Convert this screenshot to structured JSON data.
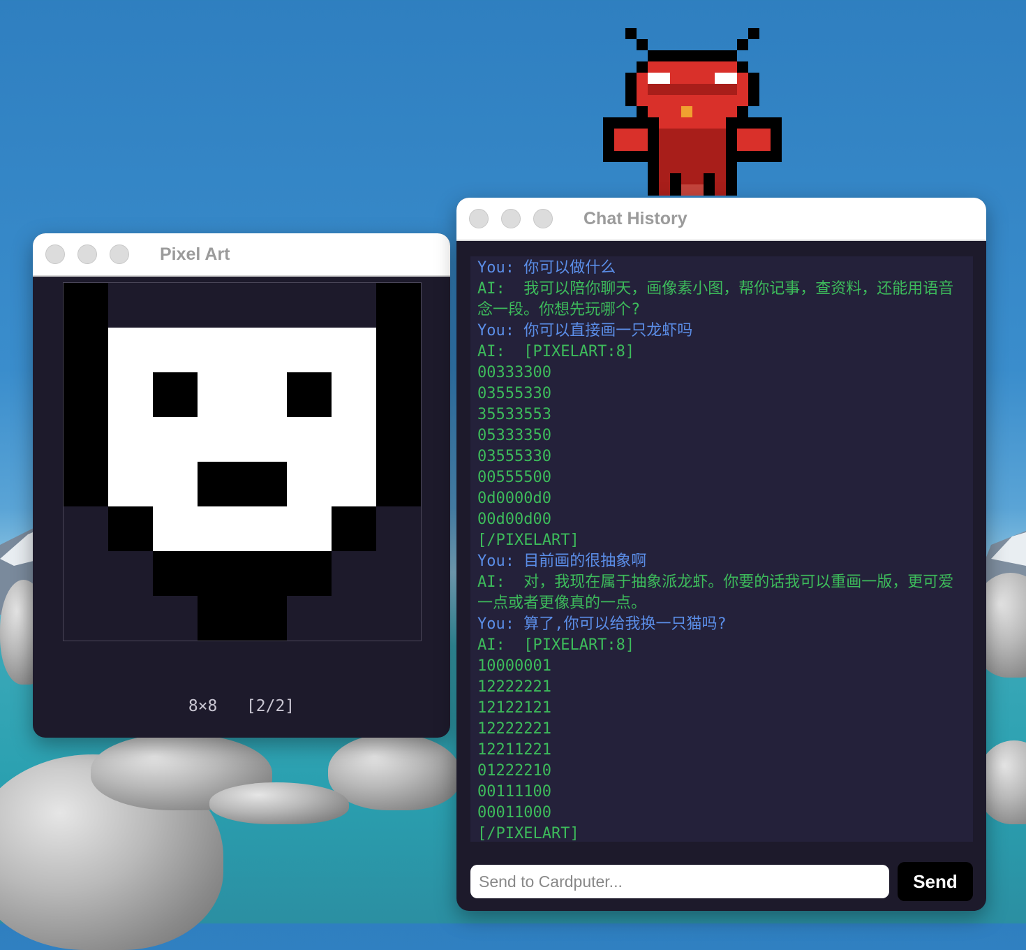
{
  "pixel_window": {
    "title": "Pixel Art",
    "caption_size": "8×8",
    "caption_page": "[2/2]",
    "rows": [
      "10000001",
      "12222221",
      "12122121",
      "12222221",
      "12211221",
      "01222210",
      "00111100",
      "00011000"
    ],
    "palette": {
      "0": "#1d1a2b",
      "1": "#000000",
      "2": "#ffffff"
    }
  },
  "chat_window": {
    "title": "Chat History",
    "messages": [
      {
        "speaker": "you",
        "text": "You: 你可以做什么"
      },
      {
        "speaker": "ai",
        "text": "AI:  我可以陪你聊天，画像素小图，帮你记事，查资料，还能用语音念一段。你想先玩哪个?"
      },
      {
        "speaker": "you",
        "text": "You: 你可以直接画一只龙虾吗"
      },
      {
        "speaker": "ai",
        "text": "AI:  [PIXELART:8]"
      },
      {
        "speaker": "ai",
        "text": "00333300"
      },
      {
        "speaker": "ai",
        "text": "03555330"
      },
      {
        "speaker": "ai",
        "text": "35533553"
      },
      {
        "speaker": "ai",
        "text": "05333350"
      },
      {
        "speaker": "ai",
        "text": "03555330"
      },
      {
        "speaker": "ai",
        "text": "00555500"
      },
      {
        "speaker": "ai",
        "text": "0d0000d0"
      },
      {
        "speaker": "ai",
        "text": "00d00d00"
      },
      {
        "speaker": "ai",
        "text": "[/PIXELART]"
      },
      {
        "speaker": "you",
        "text": "You: 目前画的很抽象啊"
      },
      {
        "speaker": "ai",
        "text": "AI:  对，我现在属于抽象派龙虾。你要的话我可以重画一版，更可爱一点或者更像真的一点。"
      },
      {
        "speaker": "you",
        "text": "You: 算了,你可以给我换一只猫吗?"
      },
      {
        "speaker": "ai",
        "text": "AI:  [PIXELART:8]"
      },
      {
        "speaker": "ai",
        "text": "10000001"
      },
      {
        "speaker": "ai",
        "text": "12222221"
      },
      {
        "speaker": "ai",
        "text": "12122121"
      },
      {
        "speaker": "ai",
        "text": "12222221"
      },
      {
        "speaker": "ai",
        "text": "12211221"
      },
      {
        "speaker": "ai",
        "text": "01222210"
      },
      {
        "speaker": "ai",
        "text": "00111100"
      },
      {
        "speaker": "ai",
        "text": "00011000"
      },
      {
        "speaker": "ai",
        "text": "[/PIXELART]"
      }
    ],
    "input_placeholder": "Send to Cardputer...",
    "input_value": "",
    "send_label": "Send"
  },
  "mascot": {
    "rows": [
      "..K..........K..",
      "...K........K...",
      "....KKKKKKKK....",
      "...KRRRRRRRRK...",
      "..KRWWRRRRWWRK..",
      "..KRDDDDDDDDRK..",
      "..KRRRRRRRRRRK..",
      "...KRRRORRRRK...",
      "KKKKKRRRRRRKKKKK",
      "KRRRKDDDDDDKRRRK",
      "KRRRKDDDDDDKRRRK",
      "KKKKKDDDDDDKKKKK",
      "....KDDDDDDK....",
      "....KDKDDKDK....",
      "....KDKPPKDK...."
    ],
    "palette": {
      ".": "transparent",
      "K": "#000000",
      "R": "#d9302a",
      "D": "#a81e1a",
      "W": "#ffffff",
      "O": "#f0a030",
      "P": "#c4443c"
    }
  }
}
